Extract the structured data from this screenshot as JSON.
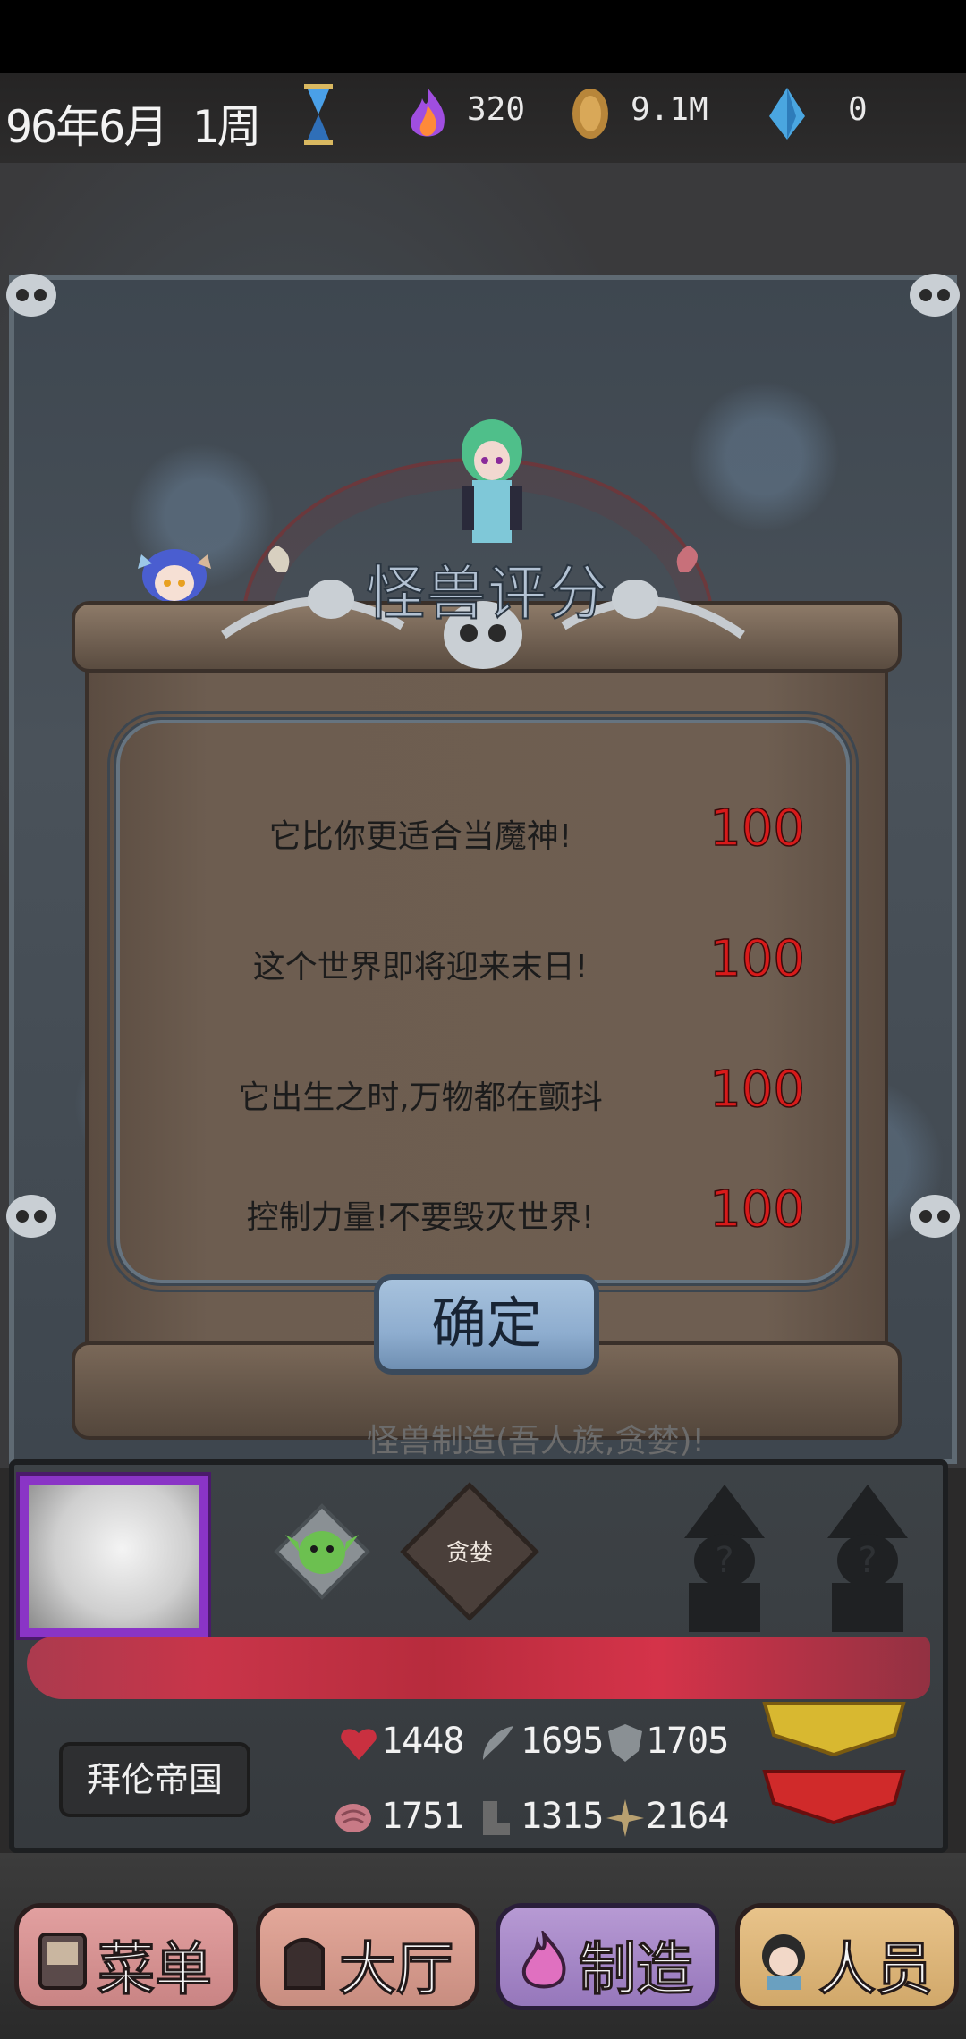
{
  "header": {
    "date": "96年6月 1周",
    "resources": [
      {
        "icon": "flame-icon",
        "value": "320"
      },
      {
        "icon": "coin-icon",
        "value": "9.1M"
      },
      {
        "icon": "crystal-icon",
        "value": "0"
      }
    ]
  },
  "dialog": {
    "title": "怪兽评分",
    "rows": [
      {
        "label": "它比你更适合当魔神!",
        "score": "100"
      },
      {
        "label": "这个世界即将迎来末日!",
        "score": "100"
      },
      {
        "label": "它出生之时,万物都在颤抖",
        "score": "100"
      },
      {
        "label": "控制力量!不要毁灭世界!",
        "score": "100"
      }
    ],
    "confirm_label": "确定"
  },
  "panel": {
    "background_text": "怪兽制造(吾人族,贪婪)!",
    "trait_badge": "贪婪",
    "nation": "拜伦帝国",
    "stats": {
      "hp": "1448",
      "attack": "1695",
      "defense": "1705",
      "intelligence": "1751",
      "speed": "1315",
      "magic": "2164"
    }
  },
  "nav": {
    "menu": "菜单",
    "hall": "大厅",
    "craft": "制造",
    "staff": "人员"
  },
  "colors": {
    "score": "#d81a1a",
    "portrait_frame": "#8a34c6",
    "confirm": "#8eadcf"
  }
}
